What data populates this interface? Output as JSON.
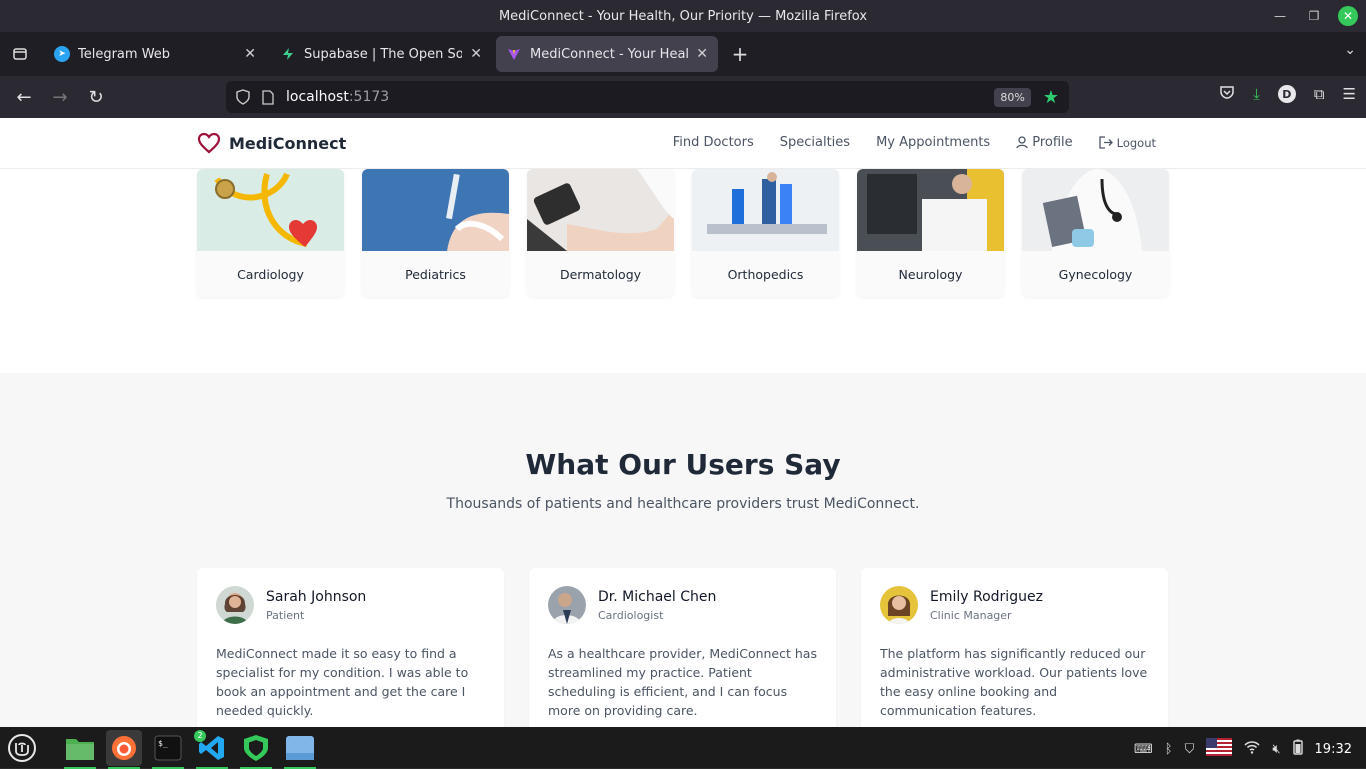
{
  "window": {
    "title": "MediConnect - Your Health, Our Priority — Mozilla Firefox"
  },
  "tabs": [
    {
      "label": "Telegram Web",
      "icon": "telegram-icon",
      "color": "#2aa3f2"
    },
    {
      "label": "Supabase | The Open Source",
      "icon": "supabase-icon",
      "color": "#3ecf8e"
    },
    {
      "label": "MediConnect - Your Health,",
      "icon": "vite-icon",
      "color": "#a855f7",
      "active": true
    }
  ],
  "urlbar": {
    "host": "localhost",
    "port": ":5173",
    "zoom": "80%"
  },
  "site": {
    "brand": "MediConnect",
    "accent": "#9f1239",
    "nav": {
      "find_doctors": "Find Doctors",
      "specialties": "Specialties",
      "appointments": "My Appointments",
      "profile": "Profile",
      "logout": "Logout"
    },
    "specialties": [
      {
        "name": "Cardiology"
      },
      {
        "name": "Pediatrics"
      },
      {
        "name": "Dermatology"
      },
      {
        "name": "Orthopedics"
      },
      {
        "name": "Neurology"
      },
      {
        "name": "Gynecology"
      }
    ],
    "testimonials": {
      "title": "What Our Users Say",
      "subtitle": "Thousands of patients and healthcare providers trust MediConnect.",
      "items": [
        {
          "name": "Sarah Johnson",
          "role": "Patient",
          "text": "MediConnect made it so easy to find a specialist for my condition. I was able to book an appointment and get the care I needed quickly."
        },
        {
          "name": "Dr. Michael Chen",
          "role": "Cardiologist",
          "text": "As a healthcare provider, MediConnect has streamlined my practice. Patient scheduling is efficient, and I can focus more on providing care."
        },
        {
          "name": "Emily Rodriguez",
          "role": "Clinic Manager",
          "text": "The platform has significantly reduced our administrative workload. Our patients love the easy online booking and communication features."
        }
      ]
    }
  },
  "taskbar": {
    "vscode_badge": "2",
    "clock": "19:32"
  }
}
